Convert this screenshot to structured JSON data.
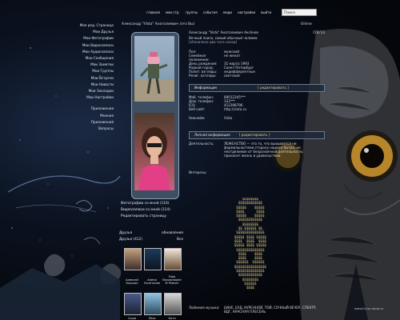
{
  "nav": {
    "items": [
      "главная",
      "мои стр.",
      "группы",
      "события",
      "люди",
      "настройки",
      "выйти"
    ],
    "search_placeholder": "Поиск"
  },
  "sidebar": {
    "items": [
      "Моя ред. Страница",
      "Мои Друзья",
      "Мои Фотографии",
      "Мои Видеозаписи",
      "Мои Аудиозаписи",
      "Мои Сообщения",
      "Мои Заметки",
      "Мои Группы",
      "Мои Встречи",
      "Мои Новости",
      "Мои Закладки",
      "Мои Настройки",
      "Приложения",
      "Мнения",
      "Приложения",
      "Вопросы"
    ]
  },
  "profile": {
    "header_left": "Александр \"Vista\" Анатолиевич (это Вы)",
    "header_right": "Online",
    "name": "Александр \"Vista\" Анатолиевич Аксёнов",
    "online_rank": "СПб'13",
    "status": "Вечный поиск, самый обычный чоловек",
    "status_sub": "[обновлено два часа назад]",
    "basic": [
      {
        "k": "Пол:",
        "v": "мужской"
      },
      {
        "k": "Семейное положение:",
        "v": "не женат"
      },
      {
        "k": "День рождения:",
        "v": "31 марта 1993"
      },
      {
        "k": "Родной город:",
        "v": "Санкт-Петербург"
      },
      {
        "k": "Полит. взгляды:",
        "v": "индифферентные"
      },
      {
        "k": "Религ. взгляды:",
        "v": "светский"
      }
    ],
    "contact_hdr": "Информация",
    "contact_hdr_link": "[ редактировать ]",
    "contact": [
      {
        "k": "Моб. телефон:",
        "v": "89012345***"
      },
      {
        "k": "Дом. телефон:",
        "v": "333***"
      },
      {
        "k": "ICQ:",
        "v": "412398796"
      },
      {
        "k": "Веб-сайт:",
        "v": "http://vista.ru"
      },
      {
        "k": "Никнейм:",
        "v": "Vista"
      }
    ],
    "personal_hdr": "Личная информация",
    "personal_hdr_link": "[ редактировать ]",
    "activity_label": "Деятельность:",
    "activity": "ЛЕЖЕНСТВО — это то, что вызывается ни формальностями сторону нашего бытия, не неотделимое от безразличной деятельности, приносит жизнь в удовольствии.",
    "interests_label": "Интересы:",
    "music_label": "Любимая музыка:",
    "music": "БИНЕ, БУД, КУРЕННОЙ, ТОЙ, СОЧНЫЙ ВЕЧЕР, СПЕКТР, ВДГ, КРАСНАЯ ПЛЕСЕНЬ"
  },
  "links": {
    "photos": "Фотографии со мной (116)",
    "videos": "Видеозаписи со мной (114)",
    "edit": "Редактировать страницу"
  },
  "friends": {
    "title": "Друзья",
    "all_label": "Все",
    "updates_label": "обновления",
    "count_label": "Друзья (412)",
    "people": [
      {
        "name": "Алексей Кошкин"
      },
      {
        "name": "Алёна Кочеткова"
      },
      {
        "name": "Fajla Bezzaraboite M Polevih"
      },
      {
        "name": "Саша"
      },
      {
        "name": "Лёха"
      },
      {
        "name": "Катя"
      }
    ]
  },
  "footer": "www.fu-ta.narod.ru",
  "colors": {
    "accent": "#e5cf92",
    "frame": "#8ea0b6"
  }
}
